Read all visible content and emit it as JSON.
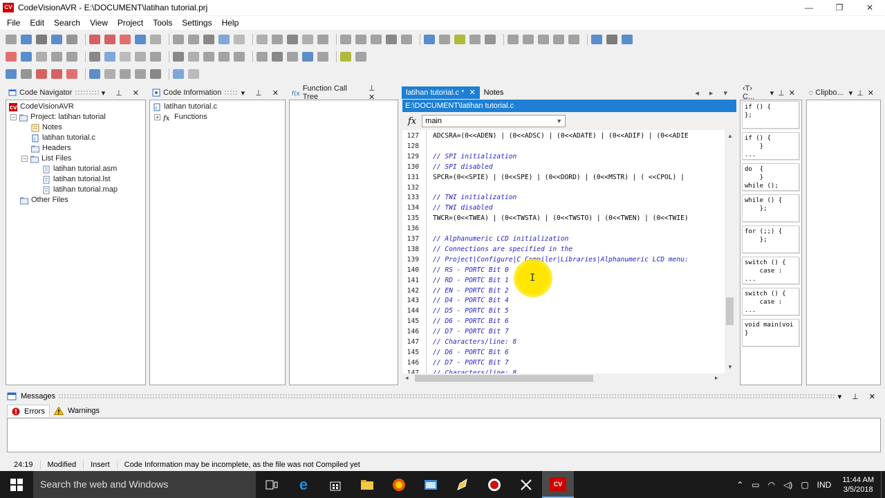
{
  "window": {
    "logo": "CV",
    "title": "CodeVisionAVR - E:\\DOCUMENT\\latihan tutorial.prj",
    "controls": [
      "—",
      "❐",
      "✕"
    ]
  },
  "menu": [
    "File",
    "Edit",
    "Search",
    "View",
    "Project",
    "Tools",
    "Settings",
    "Help"
  ],
  "panels": {
    "code_navigator": {
      "title": "Code Navigator",
      "tree": [
        {
          "label": "CodeVisionAVR",
          "level": 0,
          "icon": "cv-logo-icon"
        },
        {
          "label": "Project: latihan tutorial",
          "level": 1,
          "icon": "folder-icon",
          "expander": "−"
        },
        {
          "label": "Notes",
          "level": 2,
          "icon": "notes-icon"
        },
        {
          "label": "latihan tutorial.c",
          "level": 2,
          "icon": "c-file-icon"
        },
        {
          "label": "Headers",
          "level": 2,
          "icon": "folder-icon"
        },
        {
          "label": "List Files",
          "level": 2,
          "icon": "folder-icon",
          "expander": "−"
        },
        {
          "label": "latihan tutorial.asm",
          "level": 3,
          "icon": "file-icon"
        },
        {
          "label": "latihan tutorial.lst",
          "level": 3,
          "icon": "file-icon"
        },
        {
          "label": "latihan tutorial.map",
          "level": 3,
          "icon": "file-icon"
        },
        {
          "label": "Other Files",
          "level": 1,
          "icon": "folder-icon"
        }
      ]
    },
    "code_information": {
      "title": "Code Information",
      "tree": [
        {
          "label": "latihan tutorial.c",
          "level": 0,
          "icon": "c-file-icon"
        },
        {
          "label": "Functions",
          "level": 1,
          "icon": "fx-icon",
          "expander": "+"
        }
      ]
    },
    "function_call_tree": {
      "title": "Function Call Tree"
    },
    "templates": {
      "title": "‹T› C...",
      "items": [
        "if () {\n};",
        "if () {\n    }\n...",
        "do  {\n    }\nwhile ();",
        "while () {\n    };",
        "for (;;) {\n    };",
        "switch () {\n    case :\n...",
        "switch () {\n    case :\n...",
        "void main(voi\n}"
      ]
    },
    "clipboard": {
      "title": "Clipbo..."
    }
  },
  "editor": {
    "tabs": [
      {
        "label": "latihan tutorial.c *",
        "close": "✕",
        "active": true
      },
      {
        "label": "Notes",
        "active": false
      }
    ],
    "path": "E:\\DOCUMENT\\latihan tutorial.c",
    "fx_symbol": "fx",
    "function_select": "main",
    "lines": [
      {
        "n": "127",
        "text": "ADCSRA=(0<<ADEN) | (0<<ADSC) | (0<<ADATE) | (0<<ADIF) | (0<<ADIE",
        "comment": false
      },
      {
        "n": "128",
        "text": "",
        "comment": false
      },
      {
        "n": "129",
        "text": "// SPI initialization",
        "comment": true
      },
      {
        "n": "130",
        "text": "// SPI disabled",
        "comment": true
      },
      {
        "n": "131",
        "text": "SPCR=(0<<SPIE) | (0<<SPE) | (0<<DORD) | (0<<MSTR) | ( <<CPOL) |",
        "comment": false
      },
      {
        "n": "132",
        "text": "",
        "comment": false
      },
      {
        "n": "133",
        "text": "// TWI initialization",
        "comment": true
      },
      {
        "n": "134",
        "text": "// TWI disabled",
        "comment": true
      },
      {
        "n": "135",
        "text": "TWCR=(0<<TWEA) | (0<<TWSTA) | (0<<TWSTO) | (0<<TWEN) | (0<<TWIE)",
        "comment": false
      },
      {
        "n": "136",
        "text": "",
        "comment": false
      },
      {
        "n": "137",
        "text": "// Alphanumeric LCD initialization",
        "comment": true
      },
      {
        "n": "138",
        "text": "// Connections are specified in the",
        "comment": true
      },
      {
        "n": "139",
        "text": "// Project|Configure|C Compiler|Libraries|Alphanumeric LCD menu:",
        "comment": true
      },
      {
        "n": "140",
        "text": "// RS - PORTC Bit 0",
        "comment": true
      },
      {
        "n": "141",
        "text": "// RD - PORTC Bit 1",
        "comment": true
      },
      {
        "n": "142",
        "text": "// EN - PORTC Bit 2",
        "comment": true
      },
      {
        "n": "143",
        "text": "// D4 - PORTC Bit 4",
        "comment": true
      },
      {
        "n": "144",
        "text": "// D5 - PORTC Bit 5",
        "comment": true
      },
      {
        "n": "145",
        "text": "// D6 - PORTC Bit 6",
        "comment": true
      },
      {
        "n": "146",
        "text": "// D7 - PORTC Bit 7",
        "comment": true
      },
      {
        "n": "147",
        "text": "// Characters/line: 8",
        "comment": true
      },
      {
        "n": "145",
        "text": "// D6 - PORTC Bit 6",
        "comment": true
      },
      {
        "n": "146",
        "text": "// D7 - PORTC Bit 7",
        "comment": true
      },
      {
        "n": "147",
        "text": "// Characters/line: 8",
        "comment": true
      }
    ]
  },
  "messages": {
    "title": "Messages",
    "tabs": [
      {
        "label": "Errors",
        "icon": "error-icon"
      },
      {
        "label": "Warnings",
        "icon": "warning-icon"
      }
    ]
  },
  "status": {
    "position": "24:19",
    "modified": "Modified",
    "mode": "Insert",
    "message": "Code Information may be incomplete, as the file was not Compiled yet"
  },
  "taskbar": {
    "search_placeholder": "Search the web and Windows",
    "language": "IND",
    "time": "11:44 AM",
    "date": "3/5/2018"
  },
  "colors": {
    "accent": "#1e7fd4",
    "comment": "#2323c8",
    "highlight": "#ffe600"
  }
}
